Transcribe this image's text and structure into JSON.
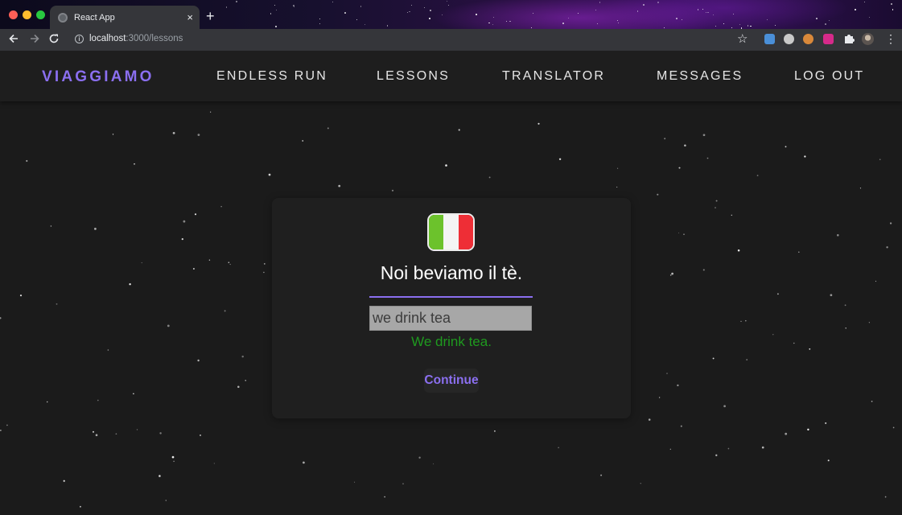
{
  "browser": {
    "tab_title": "React App",
    "tab_close": "×",
    "new_tab": "+",
    "url_host": "localhost",
    "url_path": ":3000/lessons"
  },
  "navbar": {
    "brand": "VIAGGIAMO",
    "links": [
      "ENDLESS RUN",
      "LESSONS",
      "TRANSLATOR",
      "MESSAGES",
      "LOG OUT"
    ]
  },
  "lesson": {
    "flag_colors": [
      "#6cc22c",
      "#f4f4f4",
      "#ee2e36"
    ],
    "prompt": "Noi beviamo il tè.",
    "answer_value": "we drink tea",
    "feedback": "We drink tea.",
    "continue_label": "Continue"
  },
  "colors": {
    "accent": "#8b6ff0",
    "success": "#1f9a1f"
  }
}
